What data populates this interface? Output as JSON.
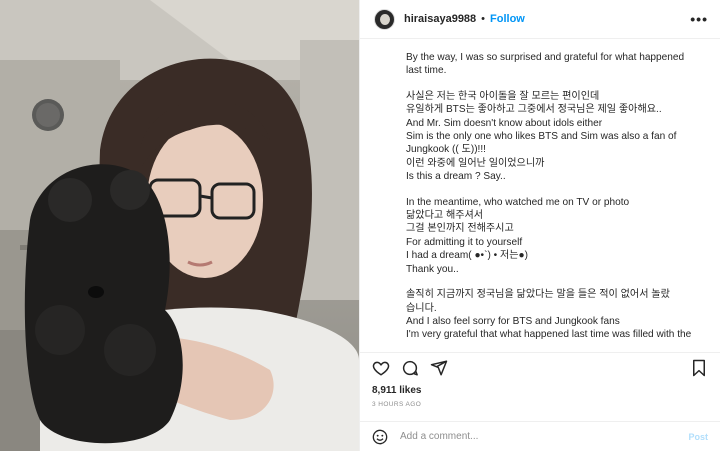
{
  "header": {
    "username": "hiraisaya9988",
    "separator": "•",
    "follow_label": "Follow",
    "more_label": "•••"
  },
  "caption": {
    "paragraphs": [
      [
        "By the way, I was so surprised and grateful for what happened",
        "last time."
      ],
      [
        "사실은 저는 한국 아이돌을 잘 모르는 편이인데",
        "유일하게 BTS는 좋아하고 그중에서 정국님은 제일 좋아해요..",
        "And Mr. Sim doesn't know about idols either",
        "Sim is the only one who likes BTS and Sim was also a fan of",
        "Jungkook (( 도))!!!",
        "이런 와중에 일어난 일이었으니까",
        "Is this a dream ? Say.."
      ],
      [
        "In the meantime, who watched me on TV or photo",
        "닮았다고 해주셔서",
        "그걸 본인까지 전해주시고",
        "For admitting it to yourself",
        "I had a dream( ●•`) • 저는●)",
        "Thank you.."
      ],
      [
        "솔직히 지금까지 정국님을 닮았다는 말을 들은 적이 없어서 놀랐",
        "습니다.",
        "And I also feel sorry for BTS and Jungkook fans",
        "I'm very grateful that what happened last time was filled with the"
      ]
    ]
  },
  "actions": {
    "like_icon": "heart-icon",
    "comment_icon": "comment-icon",
    "share_icon": "share-icon",
    "save_icon": "bookmark-icon"
  },
  "likes": "8,911 likes",
  "timestamp": "3 HOURS AGO",
  "comment_box": {
    "placeholder": "Add a comment...",
    "post_label": "Post",
    "emoji_icon": "smiley-icon"
  },
  "colors": {
    "accent": "#0095f6",
    "post_disabled": "#b2dffc",
    "border": "#efefef",
    "muted": "#8e8e8e"
  }
}
